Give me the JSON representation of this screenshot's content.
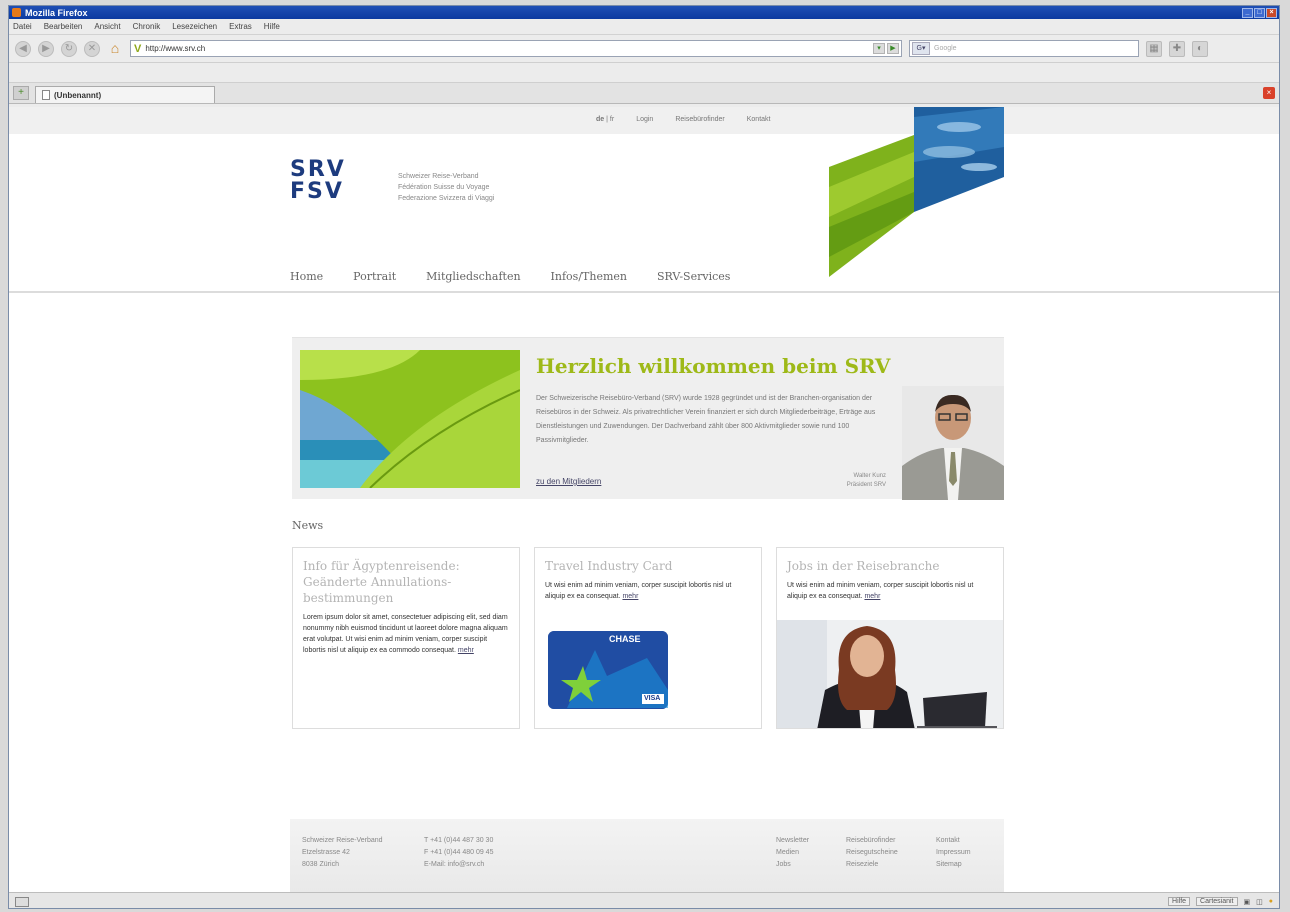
{
  "browser": {
    "title": "Mozilla Firefox",
    "menu": [
      "Datei",
      "Bearbeiten",
      "Ansicht",
      "Chronik",
      "Lesezeichen",
      "Extras",
      "Hilfe"
    ],
    "url": "http://www.srv.ch",
    "search_placeholder": "Google",
    "tab_label": "(Unbenannt)",
    "status_left": "",
    "status_right": [
      "Hilfe",
      "Cartesianit"
    ]
  },
  "site": {
    "top_links": [
      "de",
      "|",
      "fr",
      "Login",
      "Reisebürofinder",
      "Kontakt"
    ],
    "logo_line1": "SRV",
    "logo_line2": "FSV",
    "logo_text": [
      "Schweizer Reise-Verband",
      "Fédération Suisse du Voyage",
      "Federazione Svizzera di Viaggi"
    ],
    "nav": [
      "Home",
      "Portrait",
      "Mitgliedschaften",
      "Infos/Themen",
      "SRV-Services"
    ],
    "welcome": {
      "title": "Herzlich willkommen beim SRV",
      "text": "Der Schweizerische Reisebüro-Verband (SRV) wurde 1928 gegründet und ist der Branchen-organisation der Reisebüros in der Schweiz. Als privatrechtlicher Verein finanziert er sich durch Mitgliederbeiträge, Erträge aus Dienstleistungen und Zuwendungen. Der Dachverband zählt über 800 Aktivmitglieder sowie rund 100 Passivmitglieder.",
      "link": "zu den Mitgliedern",
      "caption_name": "Walter Kunz",
      "caption_role": "Präsident SRV"
    },
    "news_heading": "News",
    "news": [
      {
        "title": "Info für Ägyptenreisende: Geänderte Annullations-bestimmungen",
        "text": "Lorem ipsum dolor sit amet, consectetuer adipiscing elit, sed diam nonummy nibh euismod tincidunt ut laoreet dolore magna aliquam erat volutpat. Ut wisi enim ad minim veniam, corper suscipit lobortis nisl ut aliquip ex ea commodo consequat.",
        "more": "mehr"
      },
      {
        "title": "Travel Industry Card",
        "text": "Ut wisi enim ad minim veniam, corper suscipit lobortis nisl ut aliquip ex ea consequat.",
        "more": "mehr",
        "card_brand": "CHASE",
        "card_network": "VISA"
      },
      {
        "title": "Jobs in der Reisebranche",
        "text": "Ut wisi enim ad minim veniam, corper suscipit lobortis nisl ut aliquip ex ea consequat.",
        "more": "mehr"
      }
    ],
    "footer": {
      "address": [
        "Schweizer Reise-Verband",
        "Etzelstrasse 42",
        "8038 Zürich"
      ],
      "contact": [
        "T +41 (0)44 487 30 30",
        "F +41 (0)44 480 09 45",
        "E-Mail: info@srv.ch"
      ],
      "links_col1": [
        "Newsletter",
        "Medien",
        "Jobs"
      ],
      "links_col2": [
        "Reisebürofinder",
        "Reisegutscheine",
        "Reiseziele"
      ],
      "links_col3": [
        "Kontakt",
        "Impressum",
        "Sitemap"
      ]
    }
  },
  "colors": {
    "brand_blue": "#1d3b7e",
    "brand_green": "#9eb918"
  }
}
